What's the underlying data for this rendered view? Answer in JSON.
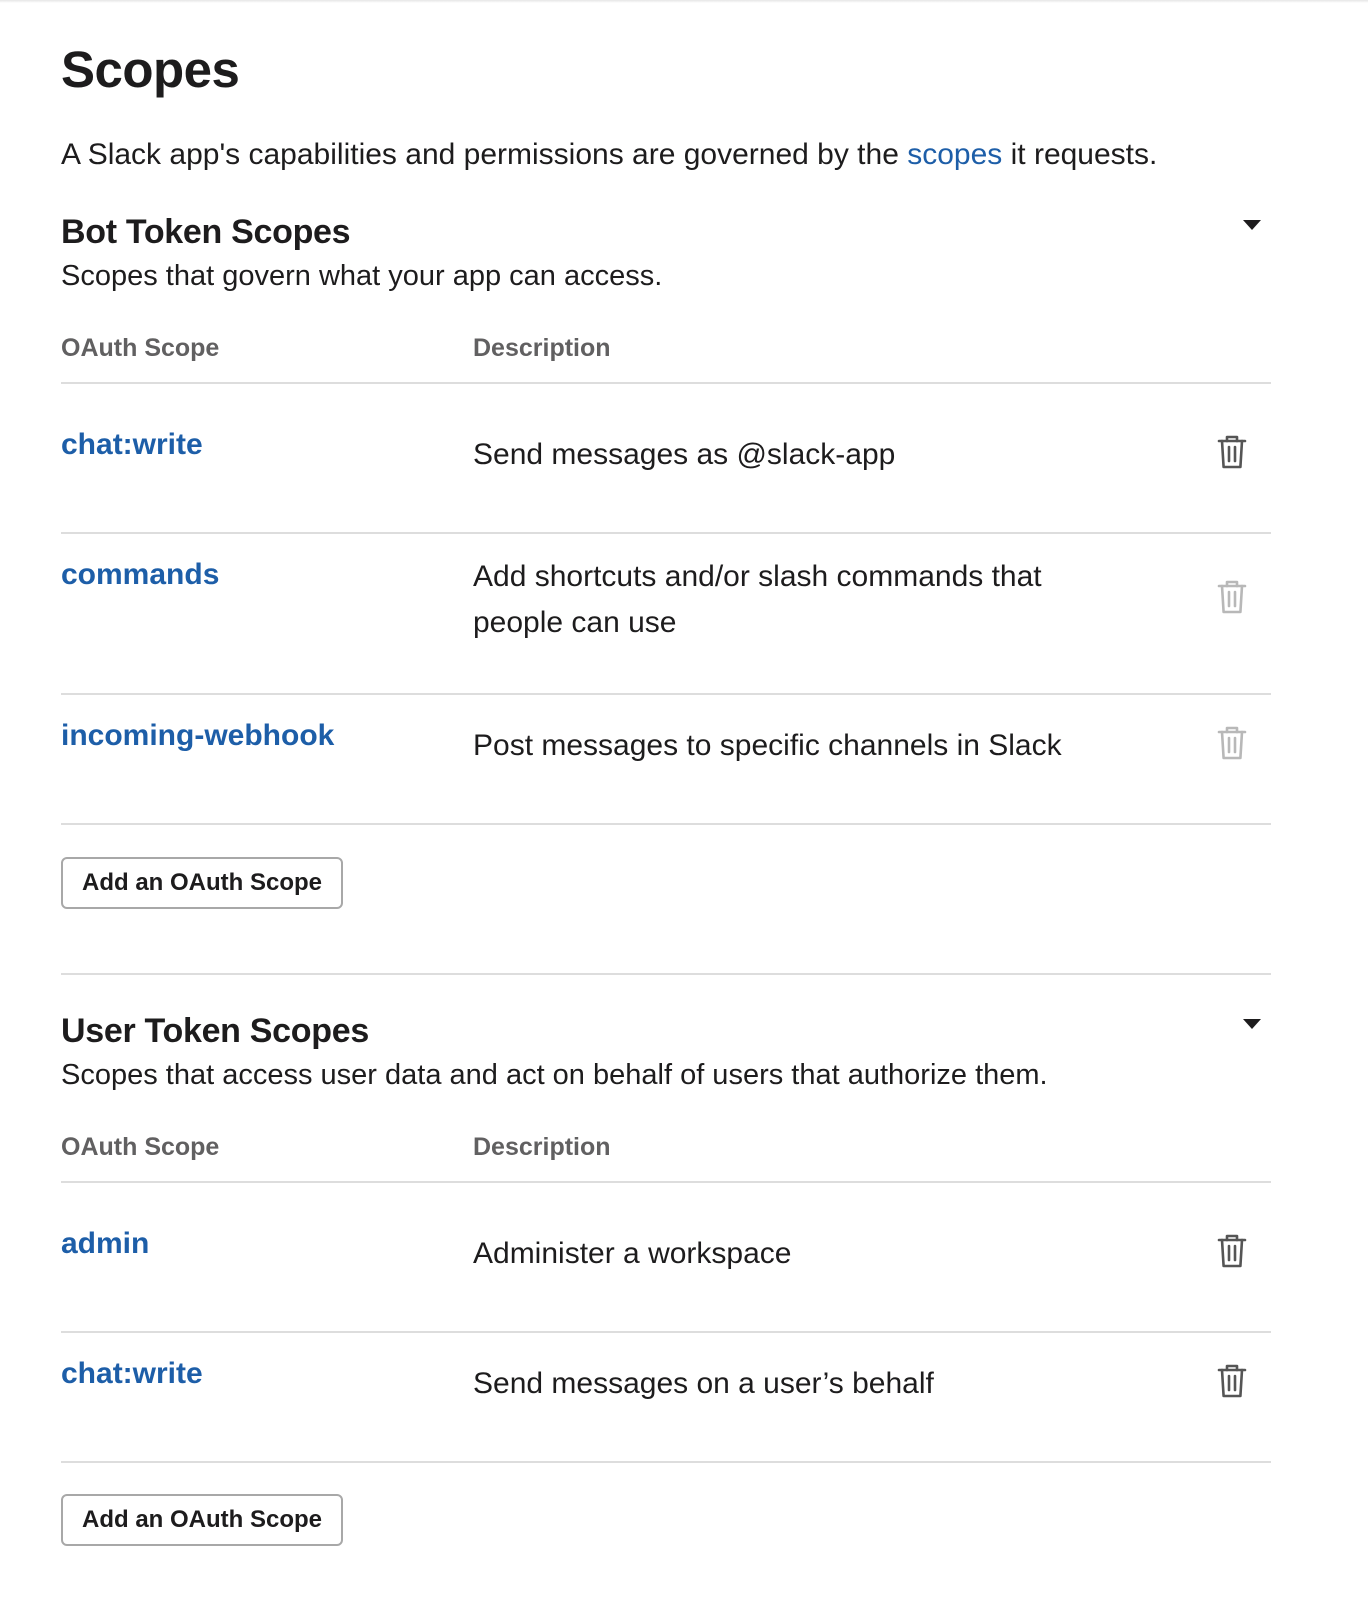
{
  "page": {
    "title": "Scopes",
    "intro_before": "A Slack app's capabilities and permissions are governed by the ",
    "intro_link": "scopes",
    "intro_after": " it requests."
  },
  "colors": {
    "link": "#1d5ea8",
    "text": "#1d1c1d",
    "muted": "#616061",
    "border": "#dddddd",
    "trash_active": "#555555",
    "trash_disabled": "#b8b8b8"
  },
  "bot": {
    "title": "Bot Token Scopes",
    "subtitle": "Scopes that govern what your app can access.",
    "col_scope": "OAuth Scope",
    "col_desc": "Description",
    "rows": [
      {
        "scope": "chat:write",
        "desc": "Send messages as @slack-app",
        "delete_icon": "trash-icon",
        "delete_enabled": true
      },
      {
        "scope": "commands",
        "desc": "Add shortcuts and/or slash commands that people can use",
        "delete_icon": "trash-icon",
        "delete_enabled": false
      },
      {
        "scope": "incoming-webhook",
        "desc": "Post messages to specific channels in Slack",
        "delete_icon": "trash-icon",
        "delete_enabled": false
      }
    ],
    "add_label": "Add an OAuth Scope",
    "toggle_icon": "caret-down-icon"
  },
  "user": {
    "title": "User Token Scopes",
    "subtitle": "Scopes that access user data and act on behalf of users that authorize them.",
    "col_scope": "OAuth Scope",
    "col_desc": "Description",
    "rows": [
      {
        "scope": "admin",
        "desc": "Administer a workspace",
        "delete_icon": "trash-icon",
        "delete_enabled": true
      },
      {
        "scope": "chat:write",
        "desc": "Send messages on a user’s behalf",
        "delete_icon": "trash-icon",
        "delete_enabled": true
      }
    ],
    "add_label": "Add an OAuth Scope",
    "toggle_icon": "caret-down-icon"
  }
}
